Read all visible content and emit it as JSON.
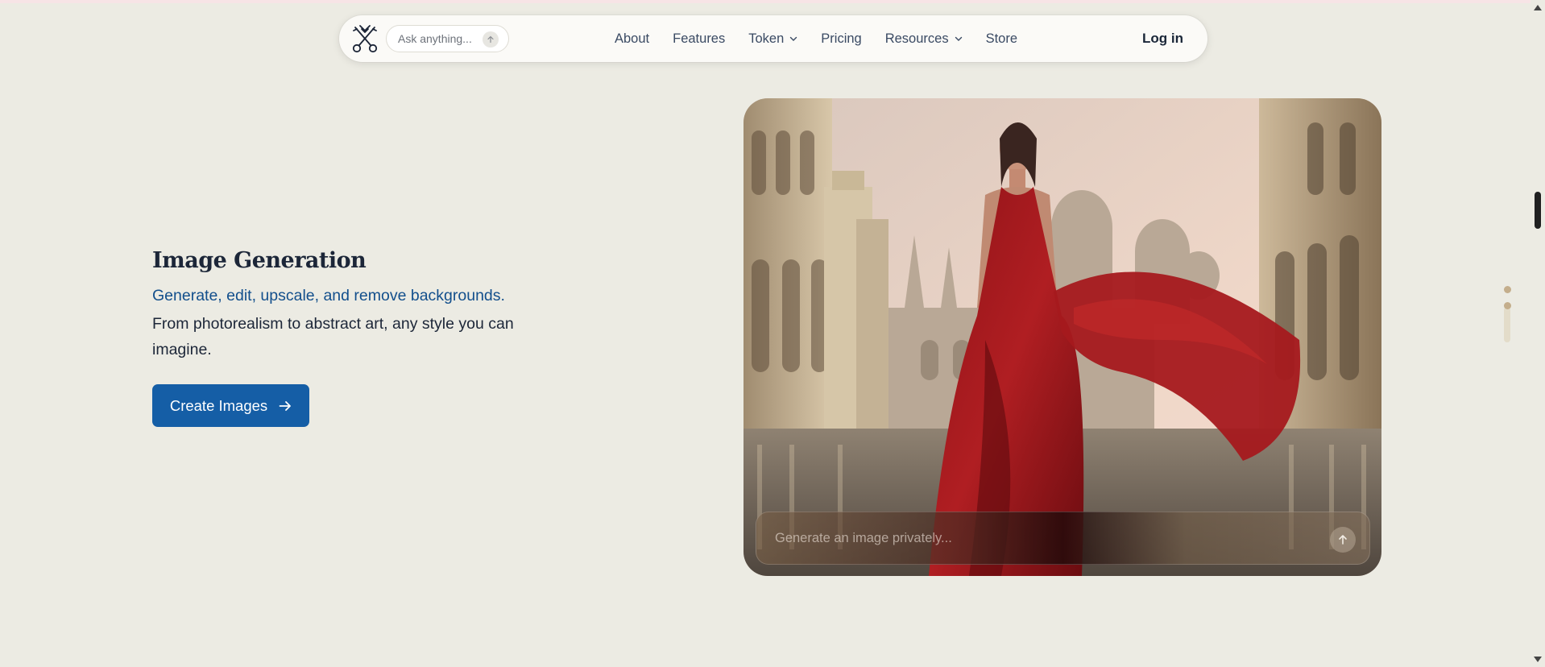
{
  "nav": {
    "logo_icon": "crossed-keys-icon",
    "ask_placeholder": "Ask anything...",
    "links": [
      {
        "label": "About",
        "has_dropdown": false
      },
      {
        "label": "Features",
        "has_dropdown": false
      },
      {
        "label": "Token",
        "has_dropdown": true
      },
      {
        "label": "Pricing",
        "has_dropdown": false
      },
      {
        "label": "Resources",
        "has_dropdown": true
      },
      {
        "label": "Store",
        "has_dropdown": false
      }
    ],
    "login_label": "Log in"
  },
  "feature": {
    "title": "Image Generation",
    "highlight": "Generate, edit, upscale, and remove backgrounds.",
    "description": "From photorealism to abstract art, any style you can imagine.",
    "cta_label": "Create Images",
    "cta_icon": "arrow-right-icon"
  },
  "image_card": {
    "prompt_placeholder": "Generate an image privately...",
    "send_icon": "arrow-up-icon"
  },
  "colors": {
    "background": "#ecebe3",
    "accent_blue": "#155ea6",
    "highlight_text": "#134f8c",
    "nav_bg": "#fbfaf7",
    "progress_gold": "#c4ae8c"
  }
}
